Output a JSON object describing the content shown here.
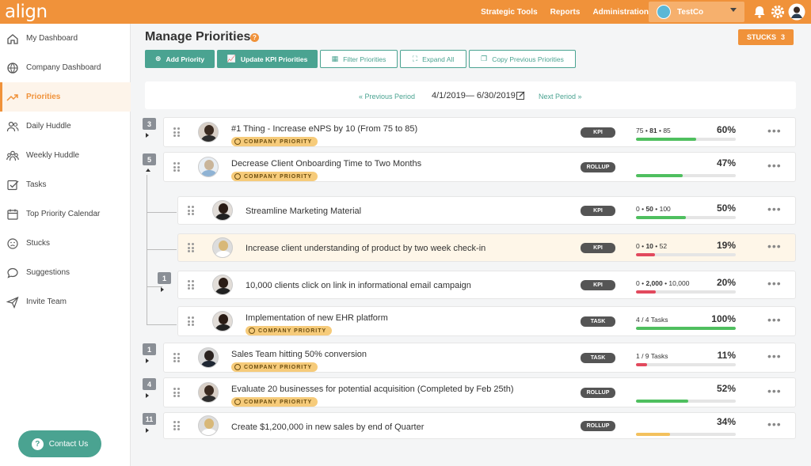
{
  "app": {
    "logo": "align"
  },
  "topnav": {
    "strategic_tools": "Strategic Tools",
    "reports": "Reports",
    "administration": "Administration",
    "company": "TestCo"
  },
  "sidebar": {
    "items": [
      {
        "label": "My Dashboard",
        "icon": "home-icon"
      },
      {
        "label": "Company Dashboard",
        "icon": "globe-icon"
      },
      {
        "label": "Priorities",
        "icon": "trend-icon",
        "active": true
      },
      {
        "label": "Daily Huddle",
        "icon": "users-icon"
      },
      {
        "label": "Weekly Huddle",
        "icon": "group-icon"
      },
      {
        "label": "Tasks",
        "icon": "checkbox-icon"
      },
      {
        "label": "Top Priority Calendar",
        "icon": "calendar-icon"
      },
      {
        "label": "Stucks",
        "icon": "frown-icon"
      },
      {
        "label": "Suggestions",
        "icon": "chat-icon"
      },
      {
        "label": "Invite Team",
        "icon": "send-icon"
      }
    ],
    "contact_label": "Contact Us"
  },
  "page": {
    "title": "Manage Priorities",
    "stucks_label": "STUCKS",
    "stucks_count": "3"
  },
  "toolbar": {
    "add_priority": "Add Priority",
    "update_kpi": "Update KPI Priorities",
    "filter": "Filter Priorities",
    "expand": "Expand All",
    "copy": "Copy Previous Priorities"
  },
  "period": {
    "prev": "« Previous Period",
    "range": "4/1/2019— 6/30/2019",
    "next": "Next Period »"
  },
  "badge_label": "COMPANY PRIORITY",
  "rows": [
    {
      "count": "3",
      "title": "#1 Thing - Increase eNPS by 10 (From 75 to 85)",
      "company": true,
      "type": "KPI",
      "prog_start": "75 • ",
      "prog_cur": "81",
      "prog_end": " • 85",
      "pct": "60%",
      "value": 0.6,
      "color": "#4fbf5f"
    },
    {
      "count": "5",
      "title": "Decrease Client Onboarding Time to Two Months",
      "company": true,
      "type": "ROLLUP",
      "prog_start": "",
      "prog_cur": "",
      "prog_end": "",
      "pct": "47%",
      "value": 0.47,
      "color": "#4fbf5f"
    },
    {
      "count": "",
      "title": "Streamline Marketing Material",
      "company": false,
      "type": "KPI",
      "prog_start": "0 • ",
      "prog_cur": "50",
      "prog_end": " • 100",
      "pct": "50%",
      "value": 0.5,
      "color": "#4fbf5f"
    },
    {
      "count": "",
      "title": "Increase client understanding of product by two week check-in",
      "company": false,
      "type": "KPI",
      "prog_start": "0 • ",
      "prog_cur": "10",
      "prog_end": " • 52",
      "pct": "19%",
      "value": 0.19,
      "color": "#e2495d"
    },
    {
      "count": "1",
      "title": "10,000 clients click on link in informational email campaign",
      "company": false,
      "type": "KPI",
      "prog_start": "0 • ",
      "prog_cur": "2,000",
      "prog_end": " • 10,000",
      "pct": "20%",
      "value": 0.2,
      "color": "#e2495d"
    },
    {
      "count": "",
      "title": "Implementation of new EHR platform",
      "company": true,
      "type": "TASK",
      "prog_start": "4 / 4 Tasks",
      "prog_cur": "",
      "prog_end": "",
      "pct": "100%",
      "value": 1.0,
      "color": "#4fbf5f"
    },
    {
      "count": "1",
      "title": "Sales Team hitting 50% conversion",
      "company": true,
      "type": "TASK",
      "prog_start": "1 / 9 Tasks",
      "prog_cur": "",
      "prog_end": "",
      "pct": "11%",
      "value": 0.11,
      "color": "#e2495d"
    },
    {
      "count": "4",
      "title": "Evaluate 20 businesses for potential acquisition (Completed by Feb 25th)",
      "company": true,
      "type": "ROLLUP",
      "prog_start": "",
      "prog_cur": "",
      "prog_end": "",
      "pct": "52%",
      "value": 0.52,
      "color": "#4fbf5f"
    },
    {
      "count": "11",
      "title": "Create $1,200,000 in new sales by end of Quarter",
      "company": false,
      "type": "ROLLUP",
      "prog_start": "",
      "prog_cur": "",
      "prog_end": "",
      "pct": "34%",
      "value": 0.34,
      "color": "#f3c15d"
    }
  ]
}
